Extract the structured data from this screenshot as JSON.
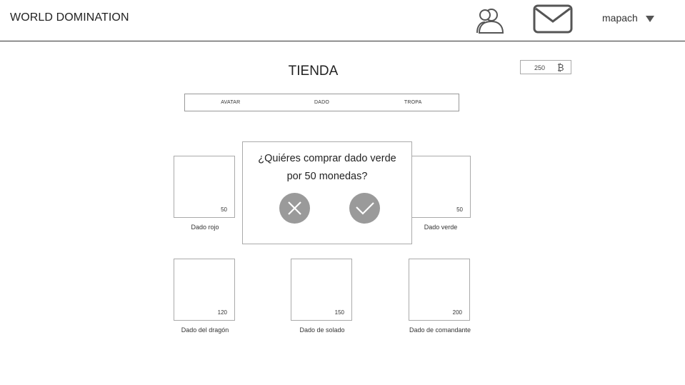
{
  "header": {
    "title": "WORLD DOMINATION",
    "username": "mapach",
    "icons": [
      "users-icon",
      "mail-icon",
      "chevron-down-icon"
    ]
  },
  "store": {
    "title": "TIENDA",
    "coins": "250",
    "coin_icon": "₿",
    "tabs": [
      "AVATAR",
      "DADO",
      "TROPA"
    ]
  },
  "products": [
    {
      "name": "Dado rojo",
      "price": "50"
    },
    {
      "name": "Dado verde",
      "price": "50"
    },
    {
      "name": "Dado del dragón",
      "price": "120"
    },
    {
      "name": "Dado de solado",
      "price": "150"
    },
    {
      "name": "Dado de comandante",
      "price": "200"
    }
  ],
  "dialog": {
    "line1": "¿Quiéres comprar dado verde",
    "line2": "por 50 monedas?",
    "icons": [
      "close-icon",
      "check-icon"
    ]
  },
  "colors": {
    "border": "#aaaaaa",
    "button": "#9a9a9a",
    "header_line": "#333333"
  }
}
